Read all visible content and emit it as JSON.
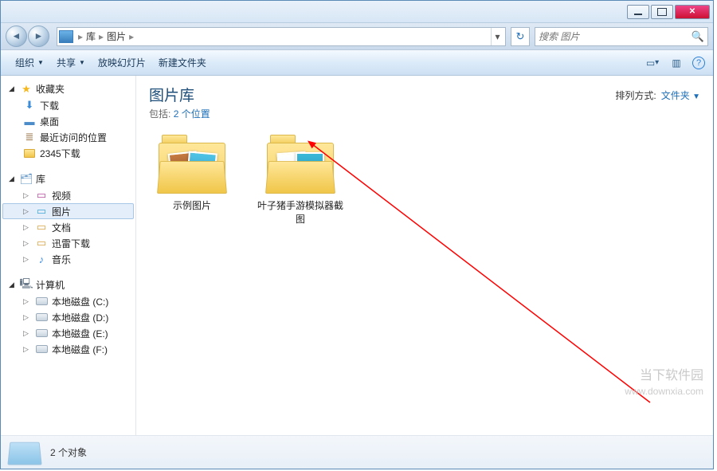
{
  "titlebar": {
    "min": "minimize",
    "max": "maximize",
    "close": "close"
  },
  "address": {
    "segments": [
      "库",
      "图片"
    ],
    "refresh": "↻"
  },
  "search": {
    "placeholder": "搜索 图片"
  },
  "toolbar": {
    "organize": "组织",
    "share": "共享",
    "slideshow": "放映幻灯片",
    "newfolder": "新建文件夹"
  },
  "sidebar": {
    "favorites": {
      "label": "收藏夹",
      "items": [
        "下载",
        "桌面",
        "最近访问的位置",
        "2345下载"
      ]
    },
    "libraries": {
      "label": "库",
      "items": [
        "视频",
        "图片",
        "文档",
        "迅雷下载",
        "音乐"
      ]
    },
    "computer": {
      "label": "计算机",
      "items": [
        "本地磁盘 (C:)",
        "本地磁盘 (D:)",
        "本地磁盘 (E:)",
        "本地磁盘 (F:)"
      ]
    }
  },
  "library": {
    "title": "图片库",
    "includes_label": "包括:",
    "includes_link": "2 个位置",
    "sort_label": "排列方式:",
    "sort_value": "文件夹"
  },
  "items": [
    {
      "name": "示例图片"
    },
    {
      "name": "叶子猪手游模拟器截图"
    }
  ],
  "status": {
    "count": "2 个对象"
  },
  "watermark": {
    "title": "当下软件园",
    "url": "www.downxia.com"
  }
}
